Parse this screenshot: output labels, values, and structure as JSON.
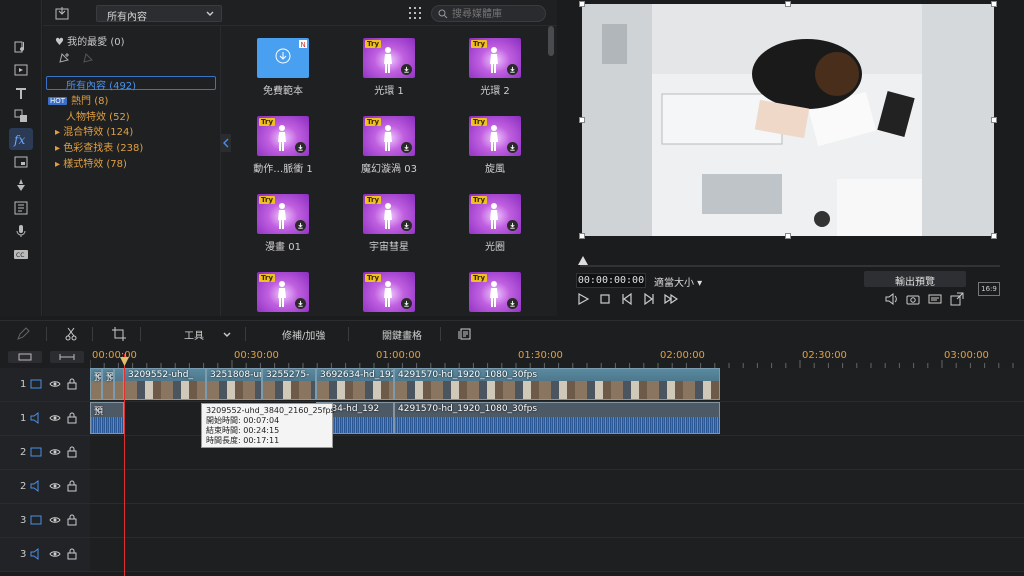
{
  "fx_panel": {
    "category_select": "所有內容",
    "search_placeholder": "搜尋媒體庫",
    "tree": {
      "favorites": "♥ 我的最愛 (0)",
      "all": "所有內容 (492)",
      "hot_badge": "HOT",
      "hot": "熱門 (8)",
      "people": "人物特效 (52)",
      "blend": "▸ 混合特效 (124)",
      "lut": "▸ 色彩查找表 (238)",
      "style": "▸ 樣式特效 (78)"
    },
    "tiles": [
      {
        "label": "免費範本",
        "kind": "blue"
      },
      {
        "label": "光環 1",
        "kind": "purple"
      },
      {
        "label": "光環 2",
        "kind": "purple"
      },
      {
        "label": "動作…脈衝 1",
        "kind": "purple"
      },
      {
        "label": "魔幻漩渦 03",
        "kind": "purple"
      },
      {
        "label": "旋風",
        "kind": "purple"
      },
      {
        "label": "漫畫 01",
        "kind": "purple"
      },
      {
        "label": "宇宙彗星",
        "kind": "purple"
      },
      {
        "label": "光圈",
        "kind": "purple"
      },
      {
        "label": "",
        "kind": "purple"
      },
      {
        "label": "",
        "kind": "purple"
      },
      {
        "label": "",
        "kind": "purple"
      }
    ],
    "try_badge": "Try"
  },
  "preview": {
    "timecode": "00:00:00:00",
    "fit_label": "適當大小 ▾",
    "export_label": "輸出預覽",
    "ratio_label": "16:9"
  },
  "timeline_toolbar": {
    "tools_label": "工具",
    "fix_label": "修補/加強",
    "keyframe_label": "關鍵畫格"
  },
  "ruler": [
    "00:00:00",
    "00:30:00",
    "01:00:00",
    "01:30:00",
    "02:00:00",
    "02:30:00",
    "03:00:00"
  ],
  "tracks": [
    {
      "num": "1",
      "type": "video"
    },
    {
      "num": "1",
      "type": "audio"
    },
    {
      "num": "2",
      "type": "video"
    },
    {
      "num": "2",
      "type": "audio"
    },
    {
      "num": "3",
      "type": "video"
    },
    {
      "num": "3",
      "type": "audio"
    }
  ],
  "video_clips": [
    "預",
    "預",
    "3209552-uhd_",
    "3251808-ur",
    "3255275-",
    "3692634-hd_192",
    "4291570-hd_1920_1080_30fps"
  ],
  "audio_clips": [
    "預",
    "2634-hd_192",
    "4291570-hd_1920_1080_30fps"
  ],
  "tooltip": {
    "name": "3209552-uhd_3840_2160_25fps",
    "start": "開始時間: 00:07:04",
    "end": "結束時間: 00:24:15",
    "duration": "時間長度: 00:17:11"
  },
  "colors": {
    "accent": "#3b72c5",
    "orange": "#e0a040",
    "playhead": "#e03030"
  }
}
